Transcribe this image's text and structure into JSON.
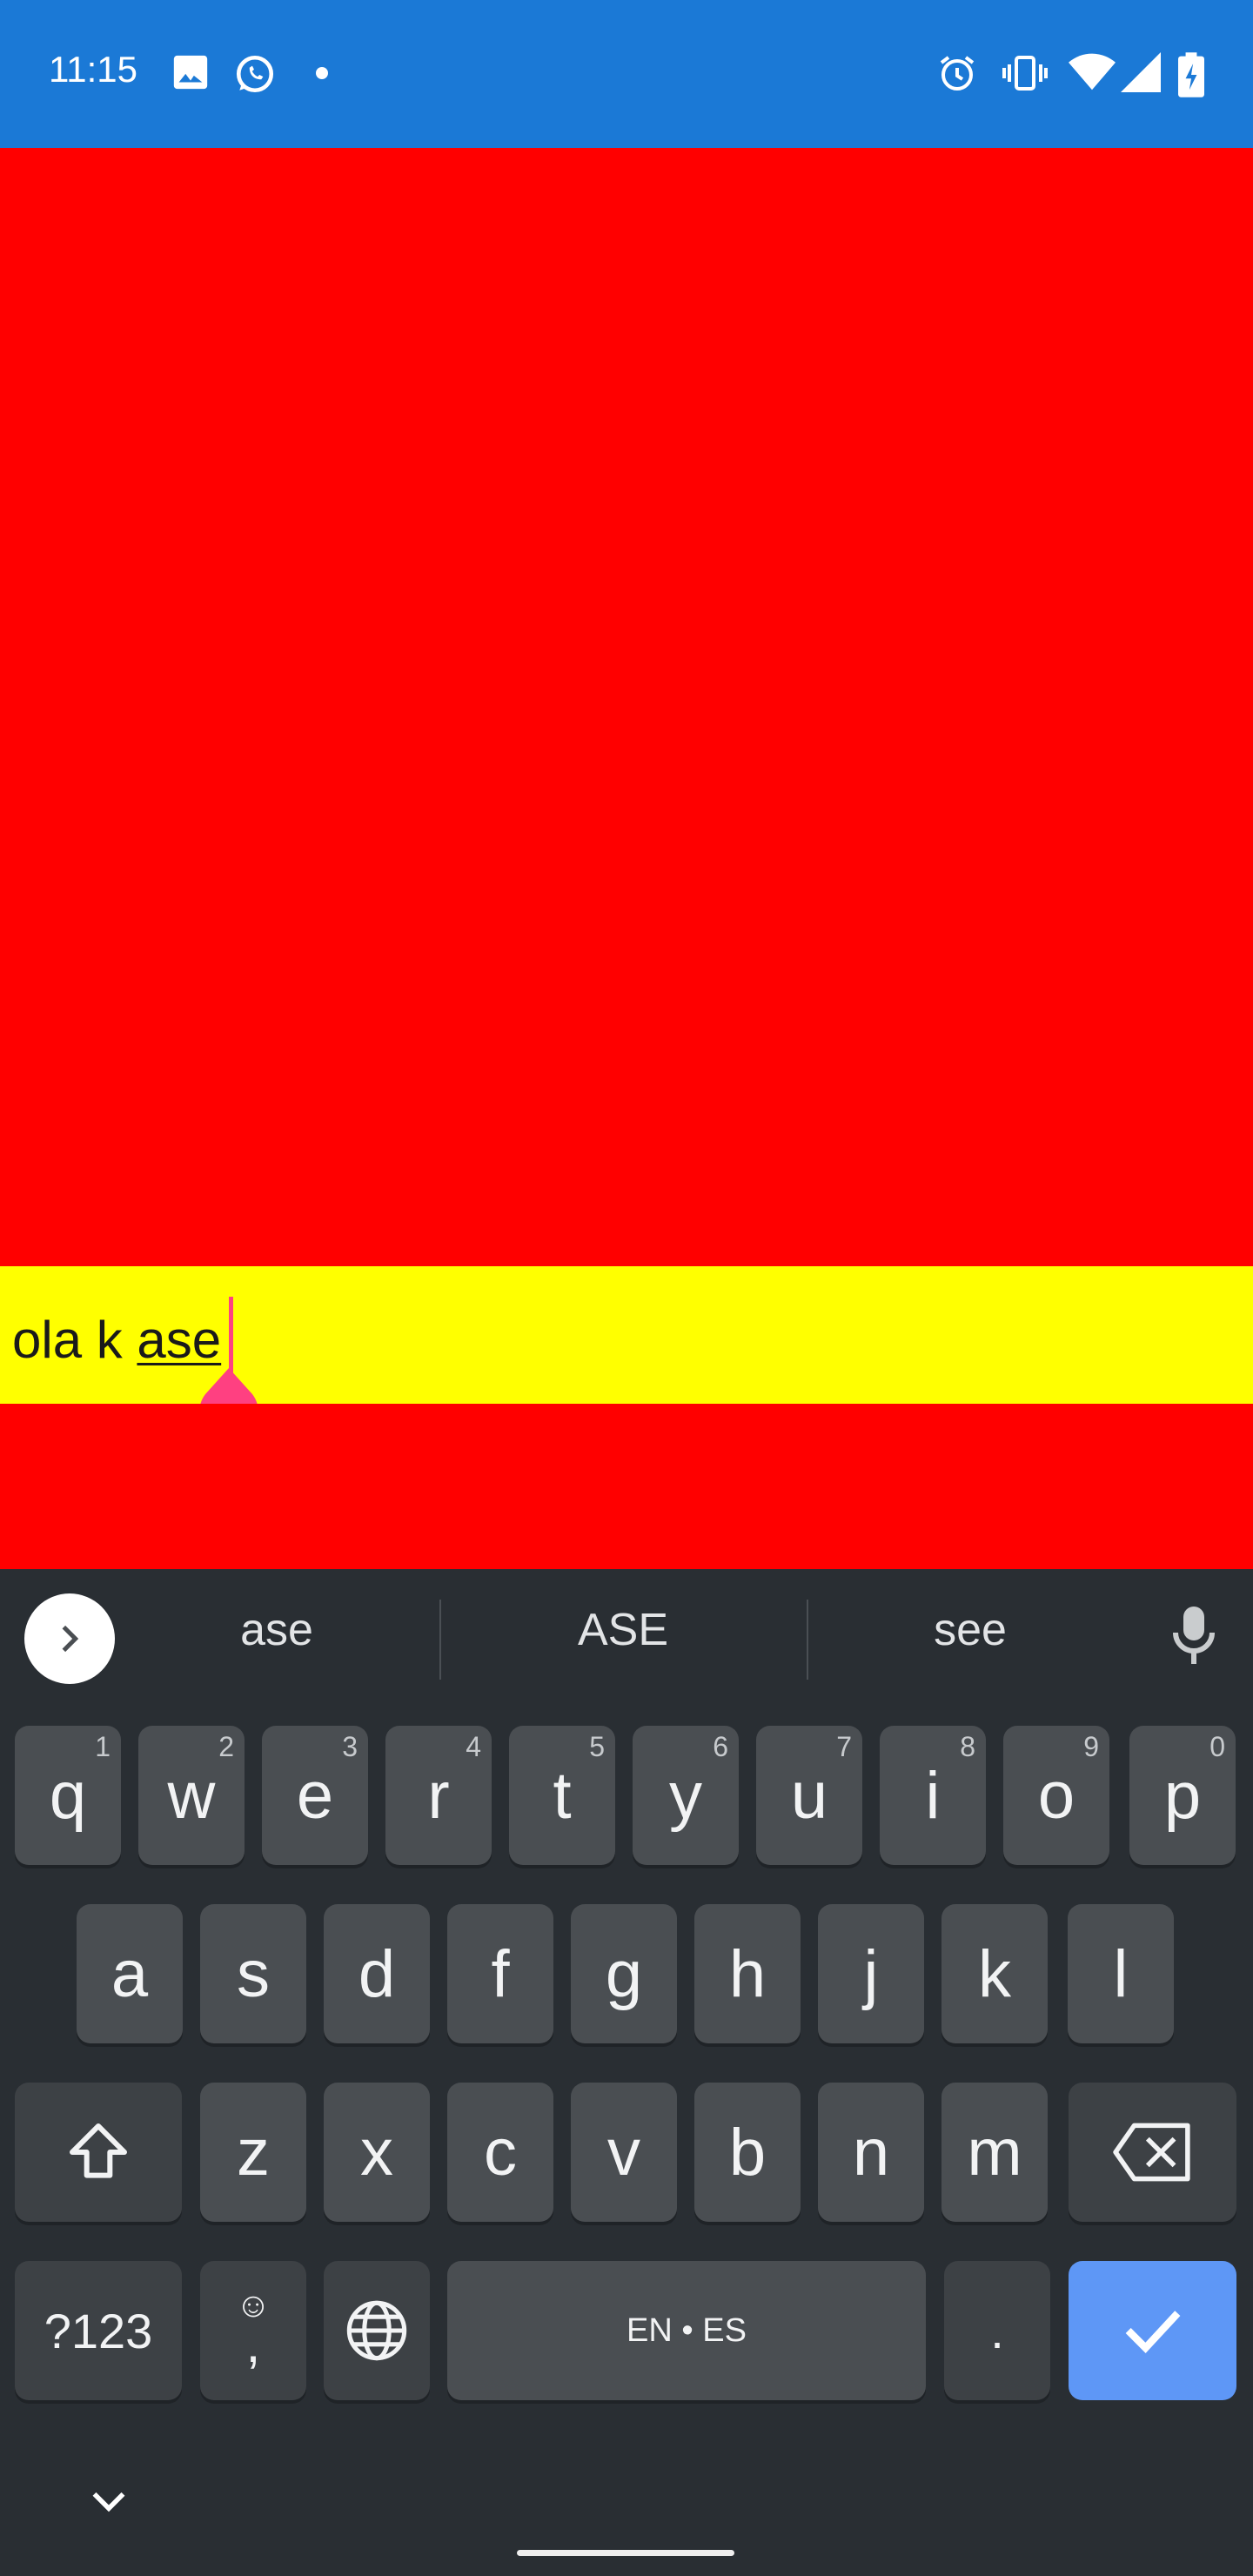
{
  "status_bar": {
    "time": "11:15",
    "background": "#1b79d6",
    "left_icons": [
      "image-icon",
      "whatsapp-icon",
      "dot-icon"
    ],
    "right_icons": [
      "alarm-icon",
      "vibrate-icon",
      "wifi-icon",
      "signal-icon",
      "battery-charging-icon"
    ]
  },
  "app": {
    "background": "#ff0000",
    "input": {
      "background": "#ffff00",
      "committed_text": "ola k ",
      "composing_text": "ase",
      "cursor_color": "#ff4081"
    }
  },
  "keyboard": {
    "background": "#292e33",
    "suggestions": [
      "ase",
      "ASE",
      "see"
    ],
    "rows": [
      [
        {
          "label": "q",
          "hint": "1"
        },
        {
          "label": "w",
          "hint": "2"
        },
        {
          "label": "e",
          "hint": "3"
        },
        {
          "label": "r",
          "hint": "4"
        },
        {
          "label": "t",
          "hint": "5"
        },
        {
          "label": "y",
          "hint": "6"
        },
        {
          "label": "u",
          "hint": "7"
        },
        {
          "label": "i",
          "hint": "8"
        },
        {
          "label": "o",
          "hint": "9"
        },
        {
          "label": "p",
          "hint": "0"
        }
      ],
      [
        {
          "label": "a"
        },
        {
          "label": "s"
        },
        {
          "label": "d"
        },
        {
          "label": "f"
        },
        {
          "label": "g"
        },
        {
          "label": "h"
        },
        {
          "label": "j"
        },
        {
          "label": "k"
        },
        {
          "label": "l"
        }
      ],
      [
        {
          "label": "z"
        },
        {
          "label": "x"
        },
        {
          "label": "c"
        },
        {
          "label": "v"
        },
        {
          "label": "b"
        },
        {
          "label": "n"
        },
        {
          "label": "m"
        }
      ]
    ],
    "symbols_label": "?123",
    "comma_label": ",",
    "emoji_label": "☺",
    "space_label": "EN • ES",
    "period_label": ".",
    "enter_color": "#5e97f6"
  }
}
